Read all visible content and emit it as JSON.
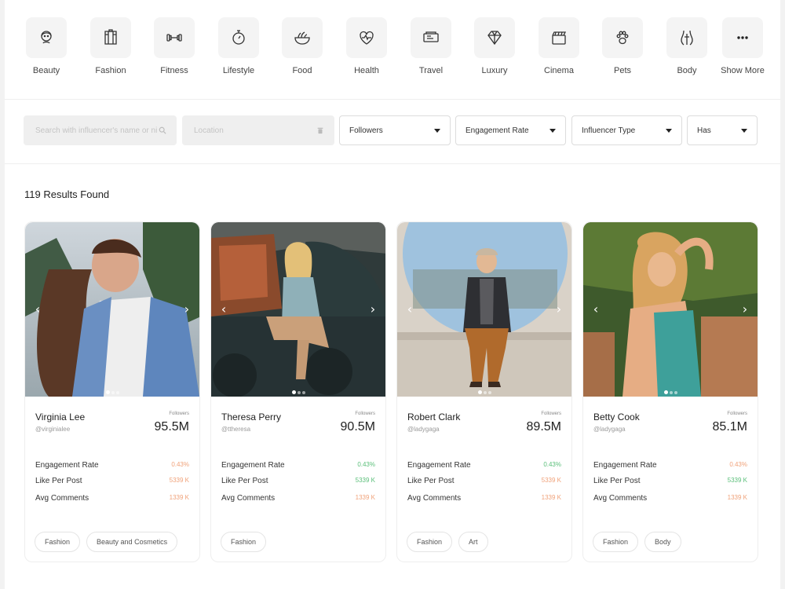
{
  "categories": [
    {
      "label": "Beauty",
      "icon": "beauty-icon"
    },
    {
      "label": "Fashion",
      "icon": "fashion-icon"
    },
    {
      "label": "Fitness",
      "icon": "dumbbell-icon"
    },
    {
      "label": "Lifestyle",
      "icon": "stopwatch-icon"
    },
    {
      "label": "Food",
      "icon": "food-bowl-icon"
    },
    {
      "label": "Health",
      "icon": "heart-pulse-icon"
    },
    {
      "label": "Travel",
      "icon": "ticket-icon"
    },
    {
      "label": "Luxury",
      "icon": "diamond-icon"
    },
    {
      "label": "Cinema",
      "icon": "clapperboard-icon"
    },
    {
      "label": "Pets",
      "icon": "paw-icon"
    },
    {
      "label": "Body",
      "icon": "body-icon"
    },
    {
      "label": "Show More",
      "icon": "more-dots-icon"
    }
  ],
  "filters": {
    "search_placeholder": "Search with influencer's name or niche",
    "location_placeholder": "Location",
    "followers": "Followers",
    "engagement_rate": "Engagement Rate",
    "influencer_type": "Influencer Type",
    "has": "Has"
  },
  "results_text": "119 Results Found",
  "colors": {
    "orange_stat": "#f0a27a",
    "green_stat": "#5bbf7a"
  },
  "cards": [
    {
      "name": "Virginia Lee",
      "handle": "@virginialee",
      "followers_label": "Followers",
      "followers": "95.5M",
      "stats": [
        {
          "label": "Engagement Rate",
          "value": "0.43%",
          "tone": "orange"
        },
        {
          "label": "Like Per Post",
          "value": "5339 K",
          "tone": "orange"
        },
        {
          "label": "Avg Comments",
          "value": "1339 K",
          "tone": "orange"
        }
      ],
      "tags": [
        "Fashion",
        "Beauty and Cosmetics"
      ]
    },
    {
      "name": "Theresa Perry",
      "handle": "@ttheresa",
      "followers_label": "Followers",
      "followers": "90.5M",
      "stats": [
        {
          "label": "Engagement Rate",
          "value": "0.43%",
          "tone": "green"
        },
        {
          "label": "Like Per Post",
          "value": "5339 K",
          "tone": "green"
        },
        {
          "label": "Avg Comments",
          "value": "1339 K",
          "tone": "orange"
        }
      ],
      "tags": [
        "Fashion"
      ]
    },
    {
      "name": "Robert Clark",
      "handle": "@ladygaga",
      "followers_label": "Followers",
      "followers": "89.5M",
      "stats": [
        {
          "label": "Engagement Rate",
          "value": "0.43%",
          "tone": "green"
        },
        {
          "label": "Like Per Post",
          "value": "5339 K",
          "tone": "orange"
        },
        {
          "label": "Avg Comments",
          "value": "1339 K",
          "tone": "orange"
        }
      ],
      "tags": [
        "Fashion",
        "Art"
      ]
    },
    {
      "name": "Betty Cook",
      "handle": "@ladygaga",
      "followers_label": "Followers",
      "followers": "85.1M",
      "stats": [
        {
          "label": "Engagement Rate",
          "value": "0.43%",
          "tone": "orange"
        },
        {
          "label": "Like Per Post",
          "value": "5339 K",
          "tone": "green"
        },
        {
          "label": "Avg Comments",
          "value": "1339 K",
          "tone": "orange"
        }
      ],
      "tags": [
        "Fashion",
        "Body"
      ]
    }
  ]
}
